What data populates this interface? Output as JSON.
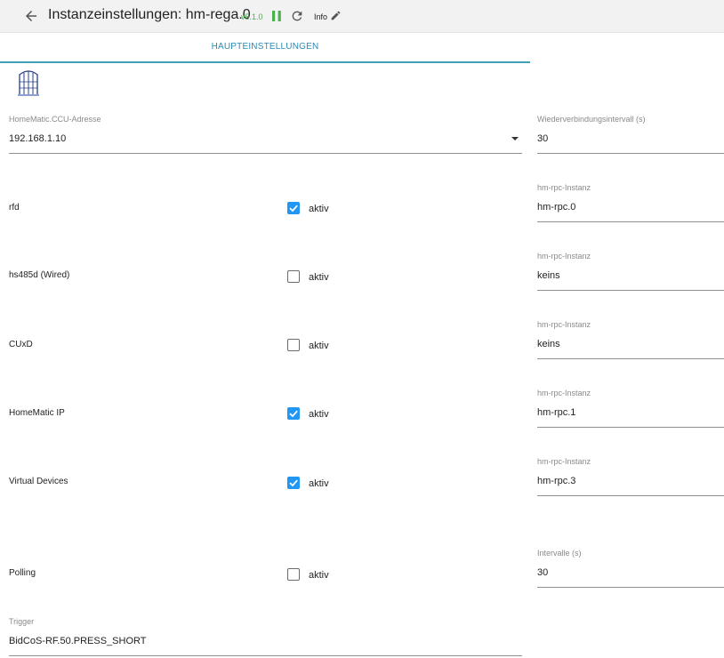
{
  "header": {
    "title": "Instanzeinstellungen: hm-rega.0",
    "version": "v5.1.0",
    "info_label": "Info"
  },
  "tabs": [
    {
      "label": "HAUPTEINSTELLUNGEN",
      "active": true
    }
  ],
  "colors": {
    "accent": "#2196f3",
    "tab_accent": "#3f9fb8",
    "version_green": "#4caf50"
  },
  "ccu_address": {
    "label": "HomeMatic.CCU-Adresse",
    "value": "192.168.1.10"
  },
  "reconnect_interval": {
    "label": "Wiederverbindungsintervall (s)",
    "value": "30"
  },
  "check_label": "aktiv",
  "daemons": [
    {
      "name": "rfd",
      "checked": true,
      "instance_label": "hm-rpc-Instanz",
      "instance_value": "hm-rpc.0"
    },
    {
      "name": "hs485d (Wired)",
      "checked": false,
      "instance_label": "hm-rpc-Instanz",
      "instance_value": "keins"
    },
    {
      "name": "CUxD",
      "checked": false,
      "instance_label": "hm-rpc-Instanz",
      "instance_value": "keins"
    },
    {
      "name": "HomeMatic IP",
      "checked": true,
      "instance_label": "hm-rpc-Instanz",
      "instance_value": "hm-rpc.1"
    },
    {
      "name": "Virtual Devices",
      "checked": true,
      "instance_label": "hm-rpc-Instanz",
      "instance_value": "hm-rpc.3"
    }
  ],
  "polling": {
    "name": "Polling",
    "checked": false,
    "interval_label": "Intervalle (s)",
    "interval_value": "30"
  },
  "trigger": {
    "label": "Trigger",
    "value": "BidCoS-RF.50.PRESS_SHORT"
  },
  "icons": {
    "back": "arrow-back-icon",
    "pause": "pause-icon",
    "reload": "reload-icon",
    "edit": "pencil-icon",
    "logo": "homematic-logo",
    "dropdown": "dropdown-arrow-icon",
    "checkbox_checked": "checkbox-checked-icon",
    "checkbox_unchecked": "checkbox-unchecked-icon"
  }
}
